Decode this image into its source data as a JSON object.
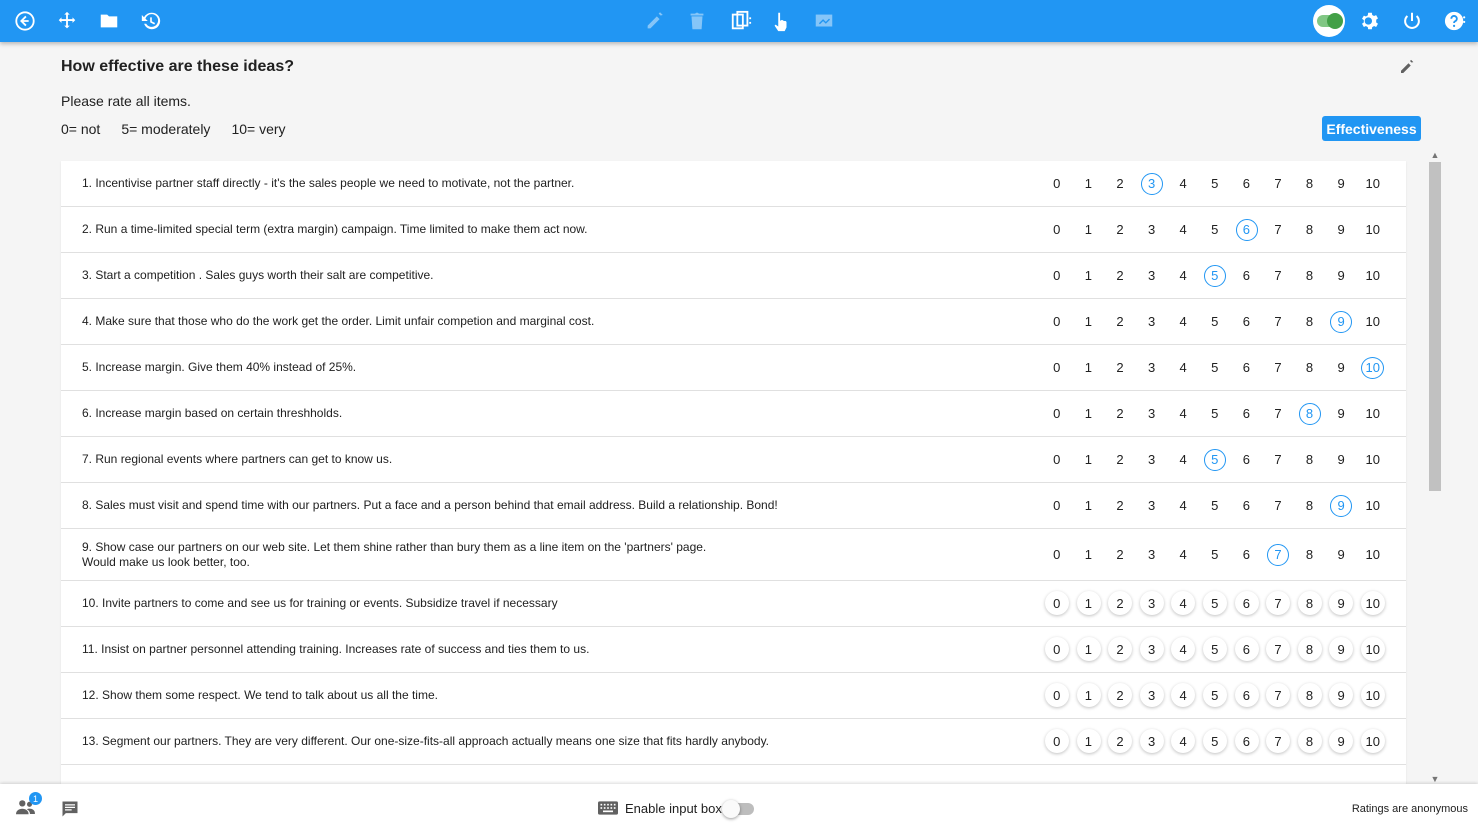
{
  "topbar": {
    "icons": [
      "back-icon",
      "move-icon",
      "folder-icon",
      "history-icon",
      "pencil-icon",
      "trash-icon",
      "copy-icon",
      "pointer-icon",
      "screen-icon",
      "toggle-icon",
      "gear-icon",
      "power-icon",
      "help-icon"
    ],
    "accent": "#2196f3"
  },
  "question": {
    "title": "How effective are these ideas?",
    "instruction": "Please rate all items.",
    "scale": [
      "0= not",
      "5= moderately",
      "10= very"
    ],
    "criterion_button": "Effectiveness"
  },
  "rating_scale": [
    "0",
    "1",
    "2",
    "3",
    "4",
    "5",
    "6",
    "7",
    "8",
    "9",
    "10"
  ],
  "items": [
    {
      "text": "1. Incentivise partner staff directly - it's the sales people we need to motivate, not the partner.",
      "rating": 3
    },
    {
      "text": "2. Run a time-limited special term (extra margin) campaign. Time limited to make them act now.",
      "rating": 6
    },
    {
      "text": "3. Start a competition . Sales guys worth their salt are competitive.",
      "rating": 5
    },
    {
      "text": "4. Make sure that those who do the work get the order. Limit unfair competion and marginal cost.",
      "rating": 9
    },
    {
      "text": "5. Increase margin. Give them 40% instead of 25%.",
      "rating": 10
    },
    {
      "text": "6. Increase margin based on certain threshholds.",
      "rating": 8
    },
    {
      "text": "7. Run regional events where partners can get to know us.",
      "rating": 5
    },
    {
      "text": "8. Sales must visit and spend time with our partners. Put a face and a person behind that email address. Build a relationship. Bond!",
      "rating": 9
    },
    {
      "text": "9. Show case our partners on our web site. Let them shine rather than bury them as a line item on the 'partners' page.",
      "text2": "Would make us look better, too.",
      "rating": 7
    },
    {
      "text": "10. Invite partners to come and see us for training or events. Subsidize travel if necessary",
      "rating": null
    },
    {
      "text": "11. Insist on partner personnel attending training. Increases rate of success and ties them to us.",
      "rating": null
    },
    {
      "text": "12. Show them some respect. We tend to talk about us all the time.",
      "rating": null
    },
    {
      "text": "13. Segment our partners. They are very different. Our one-size-fits-all approach actually means one size that fits hardly anybody.",
      "rating": null
    }
  ],
  "bottombar": {
    "participants_badge": "1",
    "enable_input_label": "Enable input box",
    "anonymous_note": "Ratings are anonymous"
  }
}
